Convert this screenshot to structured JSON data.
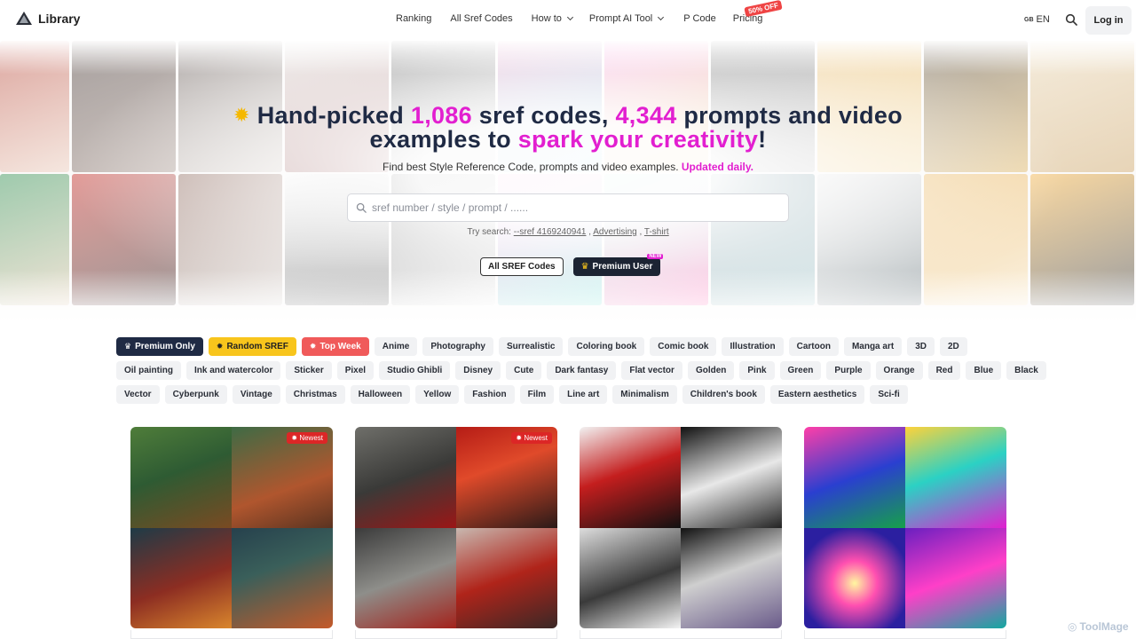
{
  "header": {
    "logo_text": "Library",
    "nav": [
      {
        "label": "Ranking",
        "has_dropdown": false
      },
      {
        "label": "All Sref Codes",
        "has_dropdown": false
      },
      {
        "label": "How to",
        "has_dropdown": true
      },
      {
        "label": "Prompt AI Tool",
        "has_dropdown": true
      },
      {
        "label": "P Code",
        "has_dropdown": false
      },
      {
        "label": "Pricing",
        "has_dropdown": false
      }
    ],
    "pricing_badge": "50% OFF",
    "lang_flag": "GB",
    "lang_label": "EN",
    "login_label": "Log in",
    "icons": {
      "search": "search-icon",
      "logo": "mountain-logo-icon"
    }
  },
  "hero": {
    "title_part1": "Hand-picked ",
    "title_sref_count": "1,086",
    "title_part2": " sref codes, ",
    "title_prompt_count": "4,344",
    "title_part3": " prompts and video",
    "title_line2_part1": "examples to ",
    "title_highlight": "spark your creativity",
    "title_end": "!",
    "subtitle": "Find best Style Reference Code, prompts and video examples. ",
    "subtitle_highlight": "Updated daily.",
    "search_placeholder": "sref number / style / prompt / ......",
    "try_label": "Try search: ",
    "try_links": [
      "--sref 4169240941",
      "Advertising",
      "T-shirt"
    ],
    "btn_all_sref": "All SREF Codes",
    "btn_premium": "Premium User",
    "btn_premium_badge": "NEW",
    "accent_color": "#e21fd0"
  },
  "tags": {
    "row1": [
      "Premium Only",
      "Random SREF",
      "Top Week",
      "Anime",
      "Photography",
      "Surrealistic",
      "Coloring book",
      "Comic book",
      "Illustration",
      "Cartoon",
      "Manga art",
      "3D",
      "2D"
    ],
    "row2": [
      "Oil painting",
      "Ink and watercolor",
      "Sticker",
      "Pixel",
      "Studio Ghibli",
      "Disney",
      "Cute",
      "Dark fantasy",
      "Flat vector",
      "Golden",
      "Pink",
      "Green",
      "Purple",
      "Orange",
      "Red",
      "Blue",
      "Black"
    ],
    "row3": [
      "Vector",
      "Cyberpunk",
      "Vintage",
      "Christmas",
      "Halloween",
      "Yellow",
      "Fashion",
      "Film",
      "Line art",
      "Minimalism",
      "Children's book",
      "Eastern aesthetics",
      "Sci-fi"
    ]
  },
  "cards": [
    {
      "badge": "Newest",
      "quadrants": [
        "warm animated family in kitchen",
        "mother cooking with child",
        "grandpa reading by the fire",
        "child in cozy workshop"
      ]
    },
    {
      "badge": "Newest",
      "quadrants": [
        "stone statue with red roses",
        "warrior on red battlefield",
        "white tiger among roses",
        "caped knight in red sky"
      ]
    },
    {
      "badge": "",
      "quadrants": [
        "manga girl in red hood",
        "manga skull",
        "manga boy with headphones",
        "manga knight on horse"
      ]
    },
    {
      "badge": "",
      "quadrants": [
        "neon american football player",
        "neon basketball player",
        "neon abstract burst",
        "neon race car"
      ]
    }
  ],
  "watermark": "ToolMage"
}
